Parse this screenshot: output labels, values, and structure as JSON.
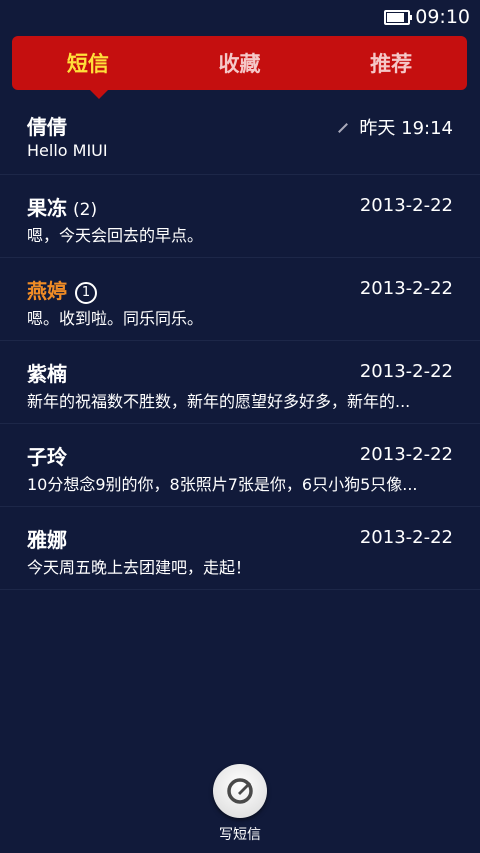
{
  "status_bar": {
    "time": "09:10",
    "battery_level": 0.85
  },
  "tabs": [
    {
      "label": "短信",
      "active": true
    },
    {
      "label": "收藏",
      "active": false
    },
    {
      "label": "推荐",
      "active": false
    }
  ],
  "conversations": [
    {
      "name": "倩倩",
      "count": "",
      "badge": "",
      "unread": false,
      "draft": true,
      "time": "昨天 19:14",
      "preview": "Hello MIUI"
    },
    {
      "name": "果冻",
      "count": "(2)",
      "badge": "",
      "unread": false,
      "draft": false,
      "time": "2013-2-22",
      "preview": "嗯，今天会回去的早点。"
    },
    {
      "name": "燕婷",
      "count": "",
      "badge": "1",
      "unread": true,
      "draft": false,
      "time": "2013-2-22",
      "preview": "嗯。收到啦。同乐同乐。"
    },
    {
      "name": "紫楠",
      "count": "",
      "badge": "",
      "unread": false,
      "draft": false,
      "time": "2013-2-22",
      "preview": "新年的祝福数不胜数，新年的愿望好多好多，新年的..."
    },
    {
      "name": "子玲",
      "count": "",
      "badge": "",
      "unread": false,
      "draft": false,
      "time": "2013-2-22",
      "preview": "10分想念9别的你，8张照片7张是你，6只小狗5只像..."
    },
    {
      "name": "雅娜",
      "count": "",
      "badge": "",
      "unread": false,
      "draft": false,
      "time": "2013-2-22",
      "preview": "今天周五晚上去团建吧，走起！"
    }
  ],
  "compose": {
    "label": "写短信",
    "icon": "compose-icon"
  },
  "colors": {
    "background": "#111a3a",
    "tab_bar": "#c50f0f",
    "tab_active": "#ffe03a",
    "unread_name": "#f08c26"
  }
}
